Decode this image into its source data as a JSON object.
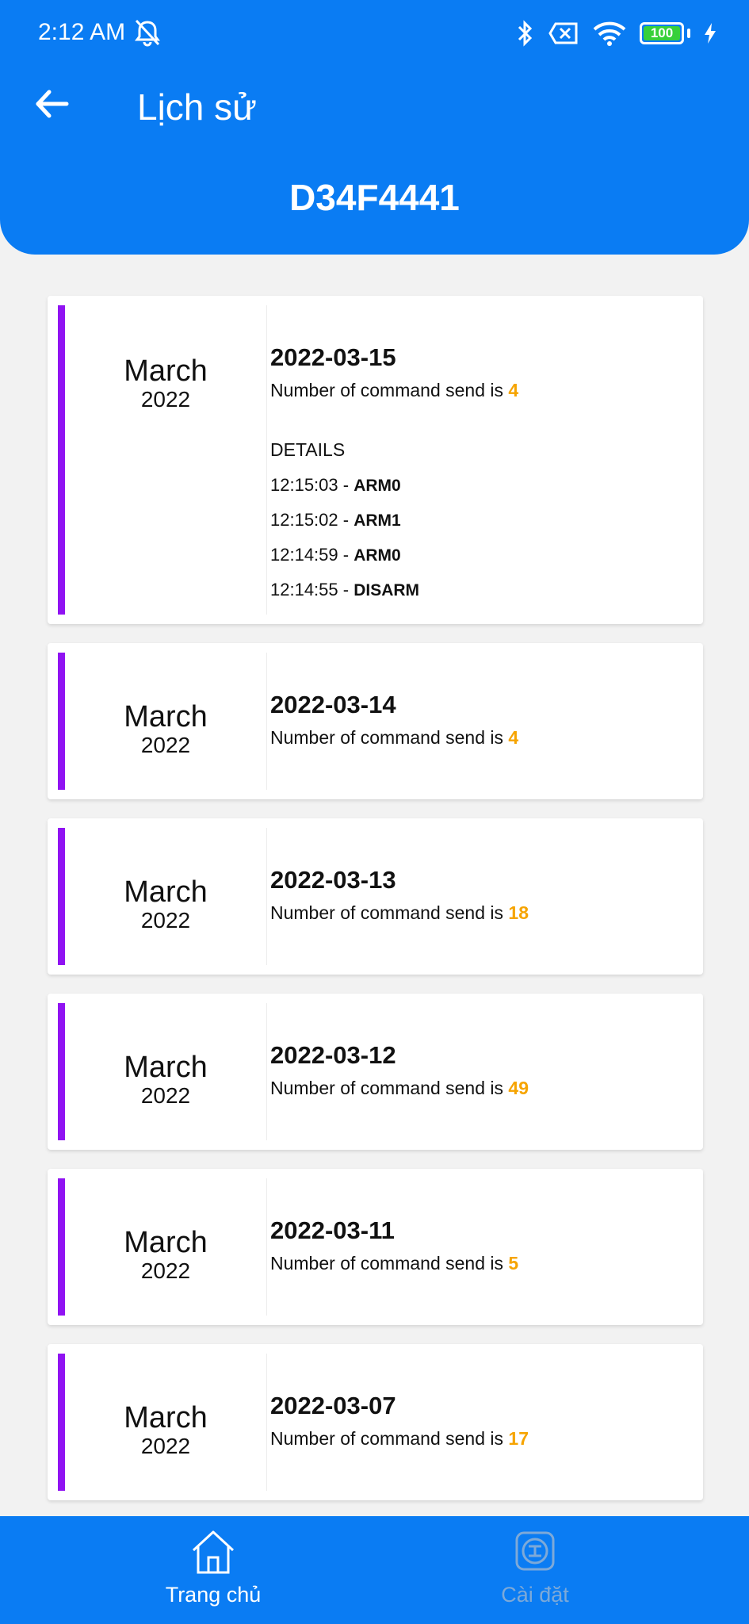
{
  "status_bar": {
    "time": "2:12 AM",
    "battery": "100",
    "icons": [
      "mute-icon",
      "bluetooth-icon",
      "no-sim-icon",
      "wifi-icon",
      "battery-icon",
      "charging-icon"
    ]
  },
  "header": {
    "title": "Lịch sử",
    "device_id": "D34F4441",
    "back_icon": "arrow-left-icon",
    "background": "#0a7cf3"
  },
  "history": [
    {
      "month": "March",
      "year": "2022",
      "date": "2022-03-15",
      "count_label": "Number of command send is ",
      "count": "4",
      "details_label": "DETAILS",
      "details": [
        {
          "time": "12:15:03 - ",
          "command": "ARM0"
        },
        {
          "time": "12:15:02 - ",
          "command": "ARM1"
        },
        {
          "time": "12:14:59 - ",
          "command": "ARM0"
        },
        {
          "time": "12:14:55 - ",
          "command": "DISARM"
        }
      ]
    },
    {
      "month": "March",
      "year": "2022",
      "date": "2022-03-14",
      "count_label": "Number of command send is ",
      "count": "4"
    },
    {
      "month": "March",
      "year": "2022",
      "date": "2022-03-13",
      "count_label": "Number of command send is ",
      "count": "18"
    },
    {
      "month": "March",
      "year": "2022",
      "date": "2022-03-12",
      "count_label": "Number of command send is ",
      "count": "49"
    },
    {
      "month": "March",
      "year": "2022",
      "date": "2022-03-11",
      "count_label": "Number of command send is ",
      "count": "5"
    },
    {
      "month": "March",
      "year": "2022",
      "date": "2022-03-07",
      "count_label": "Number of command send is ",
      "count": "17"
    }
  ],
  "colors": {
    "accent_bar": "#9013f2",
    "count_highlight": "#f6a400",
    "primary": "#0a7cf3"
  },
  "bottom_nav": {
    "home_label": "Trang chủ",
    "home_icon": "home-icon",
    "settings_label": "Cài đặt",
    "settings_icon": "settings-icon"
  }
}
